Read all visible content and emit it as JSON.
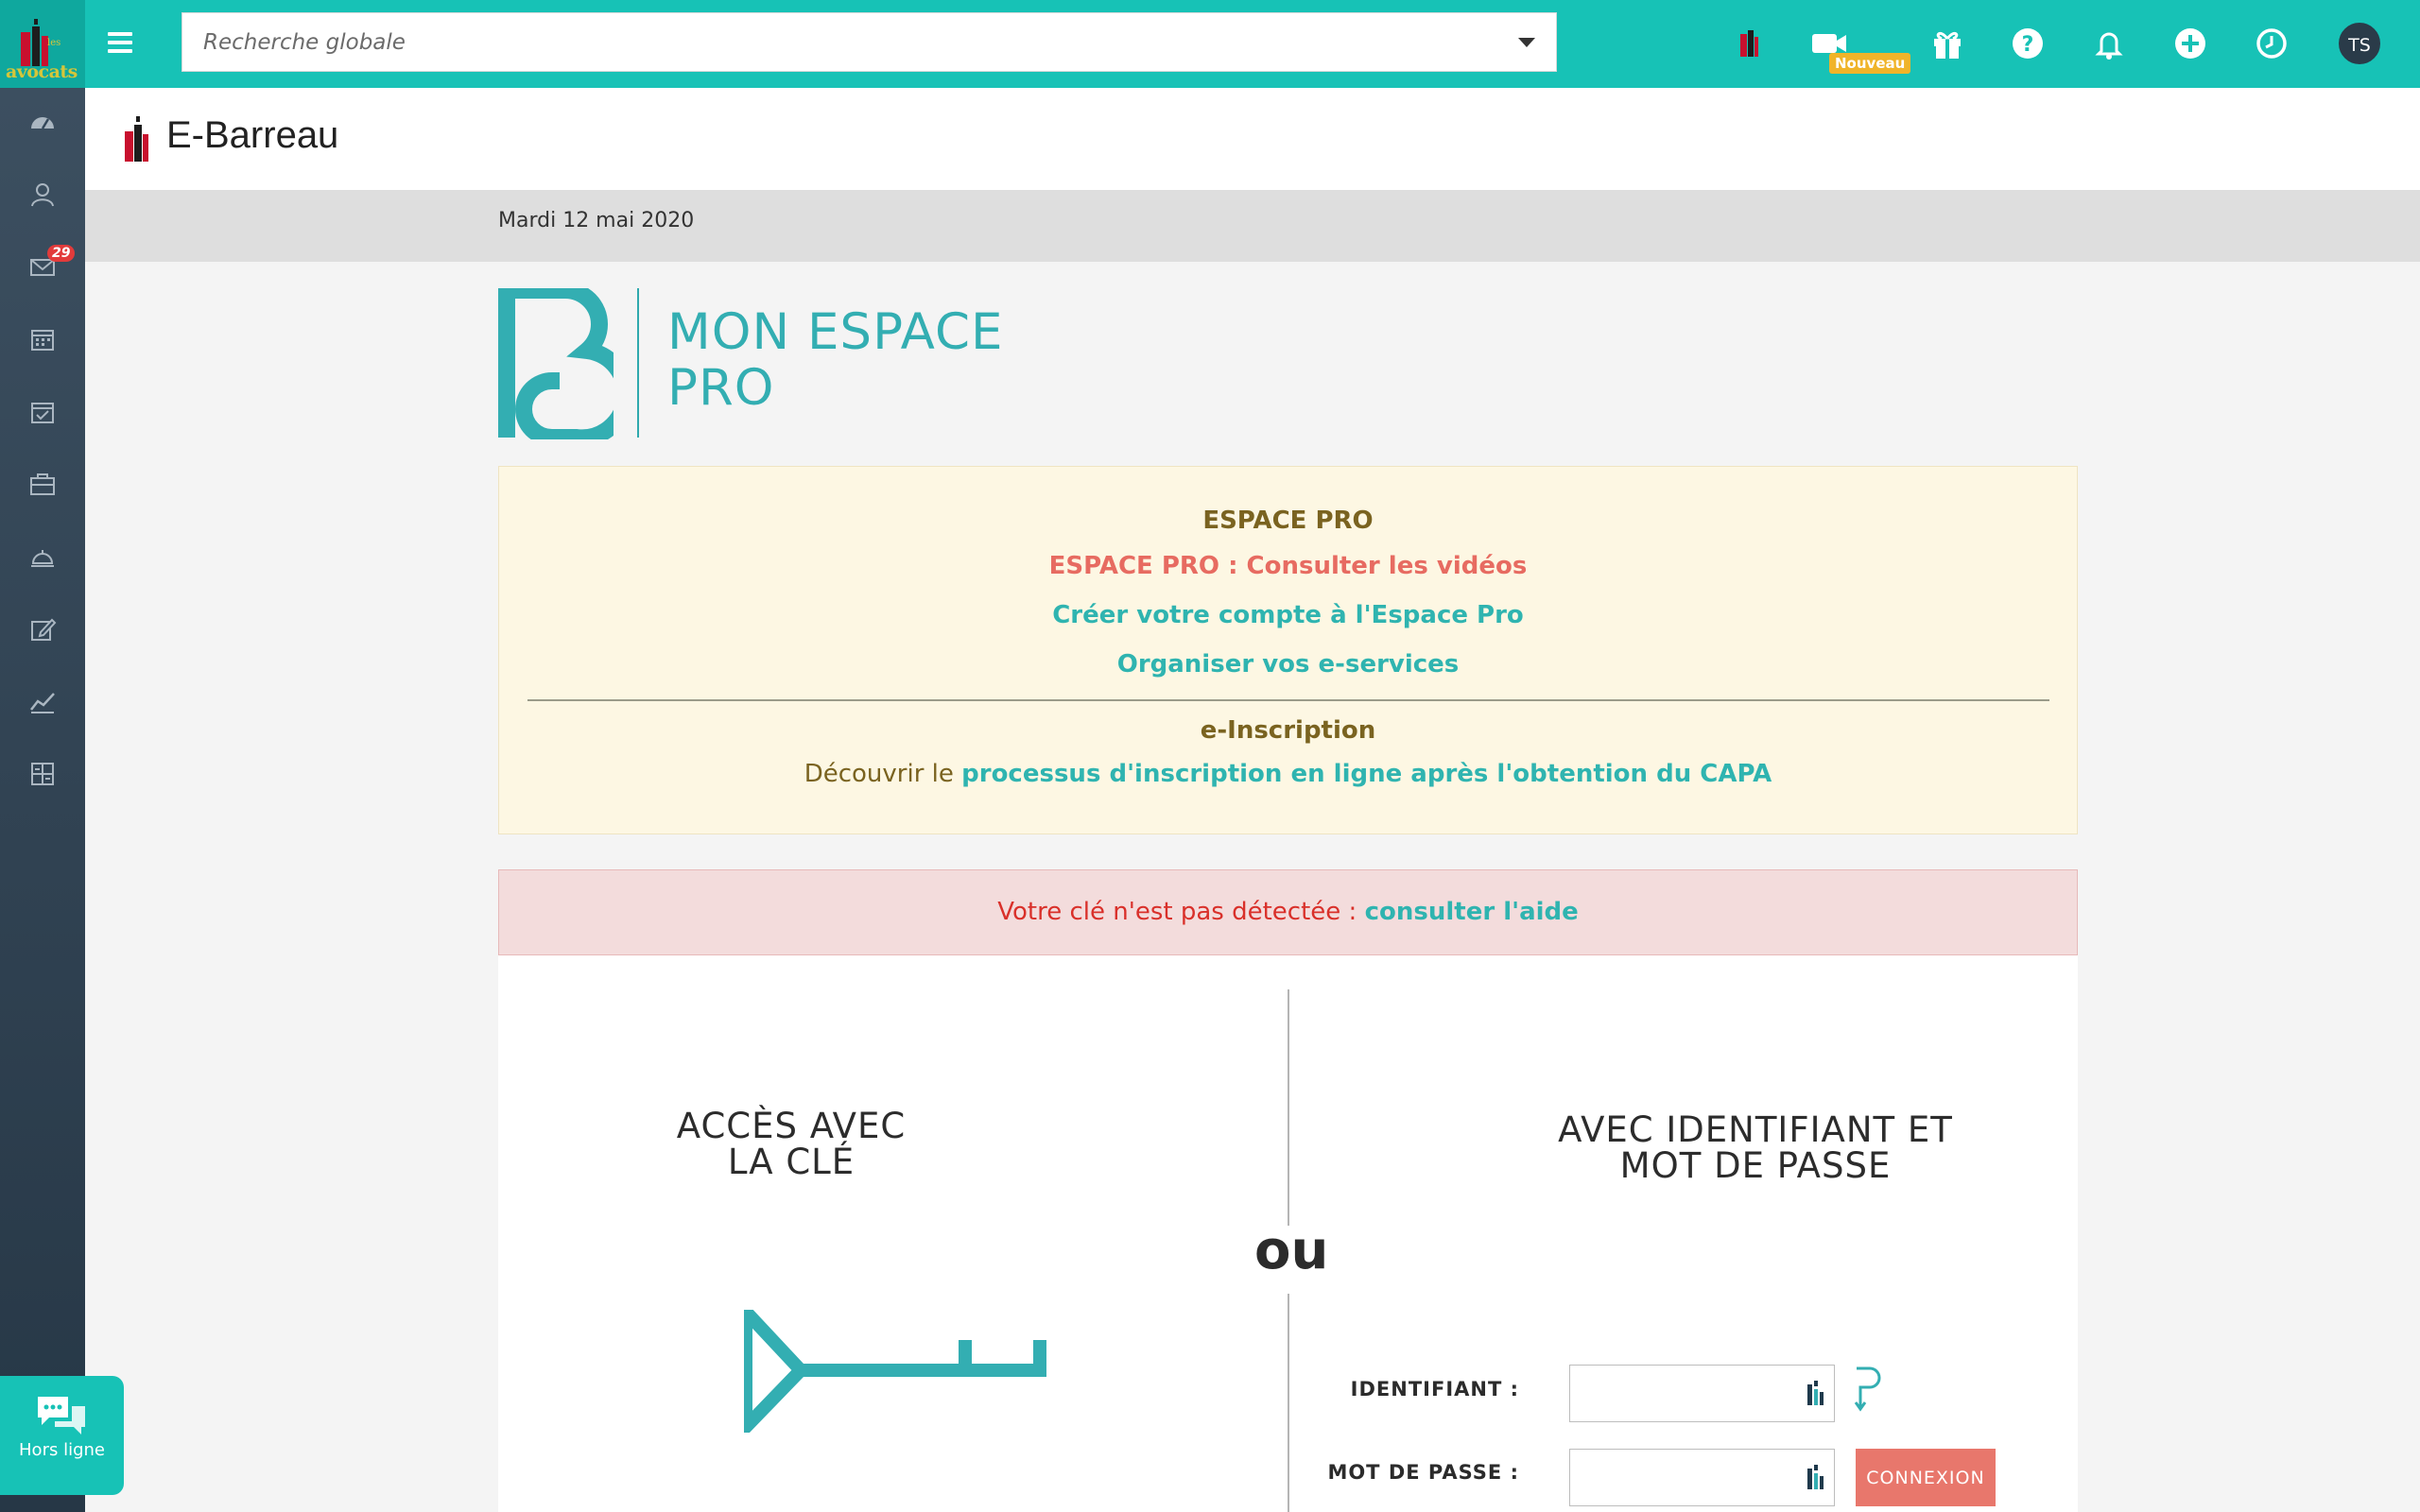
{
  "topbar": {
    "brand": "avocats",
    "brand_small": "les",
    "search_placeholder": "Recherche globale",
    "badge_new": "Nouveau",
    "avatar_initials": "TS",
    "accent_color": "#17c2b6"
  },
  "sidebar": {
    "mail_count": "29",
    "items": [
      "dashboard-icon",
      "contacts-icon",
      "mail-icon",
      "calendar-icon",
      "tasks-icon",
      "briefcase-icon",
      "reception-icon",
      "edit-icon",
      "stats-icon",
      "calculator-icon"
    ]
  },
  "page": {
    "title": "E-Barreau",
    "date": "Mardi 12 mai 2020"
  },
  "espace": {
    "line1": "MON ESPACE",
    "line2": "PRO"
  },
  "infobox": {
    "title1": "ESPACE PRO",
    "link1": "ESPACE PRO : Consulter les vidéos",
    "link2": "Créer votre compte à l'Espace Pro",
    "link3": "Organiser vos e-services",
    "title2": "e-Inscription",
    "desc_prefix": "Découvrir le ",
    "desc_link": "processus d'inscription en ligne après l'obtention du CAPA"
  },
  "alert": {
    "text": "Votre clé n'est pas détectée : ",
    "link": "consulter l'aide"
  },
  "login": {
    "left_head_line1": "ACCÈS AVEC",
    "left_head_line2": "LA CLÉ",
    "separator": "ou",
    "right_head_line1": "AVEC IDENTIFIANT ET",
    "right_head_line2": "MOT DE PASSE",
    "label_id": "IDENTIFIANT :",
    "label_pw": "MOT DE PASSE :",
    "button": "CONNEXION"
  },
  "chat": {
    "status": "Hors ligne"
  }
}
